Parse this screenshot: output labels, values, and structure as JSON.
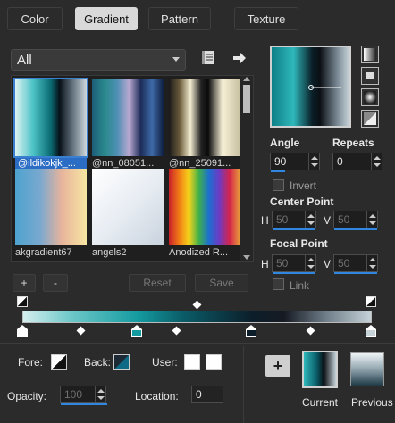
{
  "tabs": [
    {
      "label": "Color"
    },
    {
      "label": "Gradient",
      "active": true
    },
    {
      "label": "Pattern"
    },
    {
      "label": "Texture"
    }
  ],
  "library": {
    "filter": "All",
    "items": [
      {
        "name": "@ildikokjk_...",
        "selected": true
      },
      {
        "name": "@nn_08051..."
      },
      {
        "name": "@nn_25091..."
      },
      {
        "name": "akgradient67"
      },
      {
        "name": "angels2"
      },
      {
        "name": "Anodized R..."
      }
    ]
  },
  "buttons": {
    "add": "+",
    "remove": "-",
    "reset": "Reset",
    "save": "Save",
    "add_swatch": "+"
  },
  "settings": {
    "angle_label": "Angle",
    "angle_value": "90",
    "repeats_label": "Repeats",
    "repeats_value": "0",
    "invert_label": "Invert",
    "center_point_label": "Center Point",
    "center_h_label": "H",
    "center_h_value": "50",
    "center_v_label": "V",
    "center_v_value": "50",
    "focal_point_label": "Focal Point",
    "focal_h_label": "H",
    "focal_h_value": "50",
    "focal_v_label": "V",
    "focal_v_value": "50",
    "link_label": "Link"
  },
  "footer": {
    "fore_label": "Fore:",
    "back_label": "Back:",
    "user_label": "User:",
    "opacity_label": "Opacity:",
    "opacity_value": "100",
    "location_label": "Location:",
    "location_value": "0",
    "current_label": "Current",
    "previous_label": "Previous"
  },
  "colors": {
    "accent": "#2f87e0",
    "selection": "#2b6cc4",
    "panel_bg": "#2b2b2b"
  },
  "icons": [
    "library-icon",
    "arrow-right-icon",
    "linear-style-icon",
    "rectangular-style-icon",
    "sunburst-style-icon",
    "radial-style-icon",
    "add-icon"
  ]
}
